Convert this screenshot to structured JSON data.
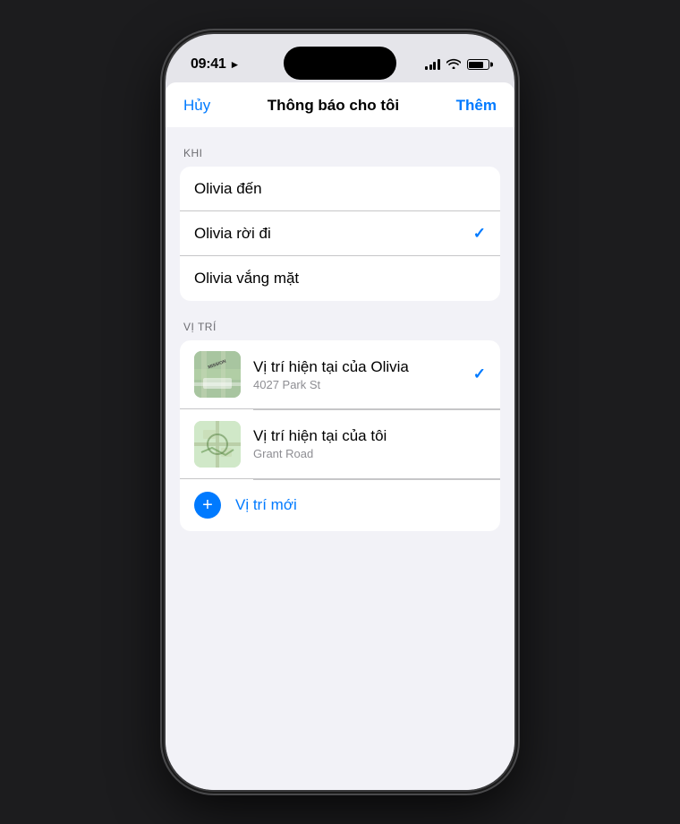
{
  "statusBar": {
    "time": "09:41",
    "locationArrow": "▶"
  },
  "navBar": {
    "cancelLabel": "Hủy",
    "title": "Thông báo cho tôi",
    "addLabel": "Thêm"
  },
  "whenSection": {
    "sectionLabel": "KHI",
    "items": [
      {
        "id": "arrive",
        "label": "Olivia đến",
        "checked": false
      },
      {
        "id": "leave",
        "label": "Olivia rời đi",
        "checked": true
      },
      {
        "id": "absent",
        "label": "Olivia vắng mặt",
        "checked": false
      }
    ]
  },
  "locationSection": {
    "sectionLabel": "VỊ TRÍ",
    "items": [
      {
        "id": "olivia-location",
        "title": "Vị trí hiện tại của Olivia",
        "subtitle": "4027 Park St",
        "checked": true,
        "mapType": "olivia"
      },
      {
        "id": "my-location",
        "title": "Vị trí hiện tại của tôi",
        "subtitle": "Grant Road",
        "checked": false,
        "mapType": "mine"
      }
    ],
    "newLocation": {
      "label": "Vị trí mới"
    }
  }
}
